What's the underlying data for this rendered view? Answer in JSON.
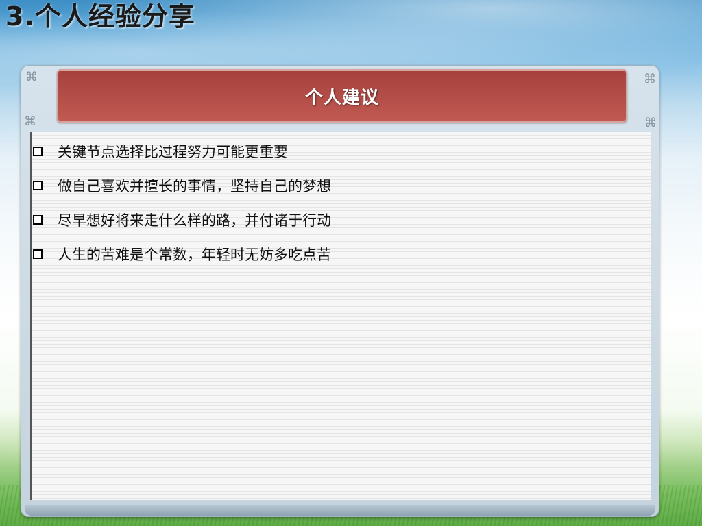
{
  "slide": {
    "title": "3.个人经验分享",
    "header": "个人建议",
    "bullets": [
      "关键节点选择比过程努力可能更重要",
      "做自己喜欢并擅长的事情，坚持自己的梦想",
      "尽早想好将来走什么样的路，并付诸于行动",
      "人生的苦难是个常数，年轻时无妨多吃点苦"
    ]
  },
  "colors": {
    "header_bar": "#b24c46",
    "sky": "#3d8fc6",
    "grass": "#5aa842",
    "frame": "#c4d3de"
  },
  "icons": {
    "bullet": "hollow-square-bullet-icon",
    "corner": "ornament-icon"
  }
}
